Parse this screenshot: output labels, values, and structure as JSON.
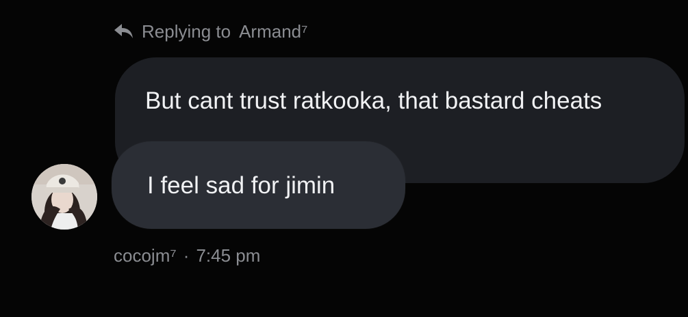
{
  "reply": {
    "prefix": "Replying to",
    "username": "Armand⁷",
    "icon": "reply-arrow-icon"
  },
  "messages": [
    {
      "text": "But cant trust ratkooka, that bastard cheats"
    },
    {
      "text": "I feel sad for jimin"
    }
  ],
  "sender": {
    "name": "cocojm⁷",
    "time": "7:45 pm",
    "separator": "·"
  },
  "colors": {
    "background": "#050505",
    "bubble_primary": "#1d1f24",
    "bubble_secondary": "#2b2e35",
    "muted_text": "#8b8d92",
    "message_text": "#f1f2f4"
  }
}
